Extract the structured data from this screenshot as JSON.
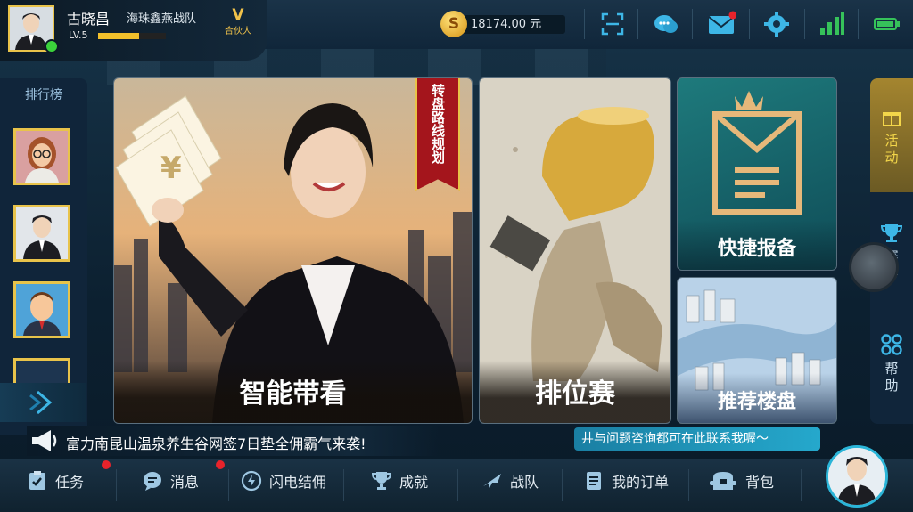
{
  "user": {
    "name": "古晓昌",
    "team": "海珠鑫燕战队",
    "level": "LV.5",
    "level_progress": 0.6,
    "vip_mark": "V",
    "vip_label": "合伙人"
  },
  "wallet": {
    "coin_symbol": "S",
    "balance": "18174.00 元"
  },
  "top_icons": [
    "scan-icon",
    "chat-icon",
    "mail-icon",
    "settings-icon",
    "signal-icon",
    "battery-icon"
  ],
  "ranking": {
    "title": "排行榜",
    "avatars": [
      "avatar-woman-glasses",
      "avatar-man-suit",
      "avatar-man-cartoon",
      "avatar-partial"
    ]
  },
  "cards": {
    "smart_viewing": {
      "label": "智能带看",
      "ribbon": "转盘路线规划",
      "yen": "¥"
    },
    "ranked_match": {
      "label": "排位赛"
    },
    "quick_report": {
      "label": "快捷报备"
    },
    "recommended": {
      "label": "推荐楼盘"
    }
  },
  "sidebar": {
    "items": [
      {
        "label": "活动",
        "icon": "gift-icon"
      },
      {
        "label": "赛事",
        "icon": "trophy-icon"
      },
      {
        "label": "帮助",
        "icon": "grid-icon"
      }
    ]
  },
  "marquee": {
    "text": "富力南昆山温泉养生谷网签7日垫全佣霸气来袭!"
  },
  "tip": {
    "text": "井与问题咨询都可在此联系我喔～"
  },
  "bottom_nav": [
    {
      "label": "任务",
      "icon": "task-icon",
      "badge": true
    },
    {
      "label": "消息",
      "icon": "message-icon",
      "badge": true
    },
    {
      "label": "闪电结佣",
      "icon": "lightning-coin-icon",
      "badge": false
    },
    {
      "label": "成就",
      "icon": "trophy-icon",
      "badge": false
    },
    {
      "label": "战队",
      "icon": "jet-icon",
      "badge": false
    },
    {
      "label": "我的订单",
      "icon": "order-icon",
      "badge": false
    },
    {
      "label": "背包",
      "icon": "backpack-icon",
      "badge": false
    }
  ],
  "colors": {
    "accent_gold": "#e8c34a",
    "accent_teal": "#25a8cc",
    "badge_red": "#e8232b",
    "online_green": "#3bd23b"
  }
}
